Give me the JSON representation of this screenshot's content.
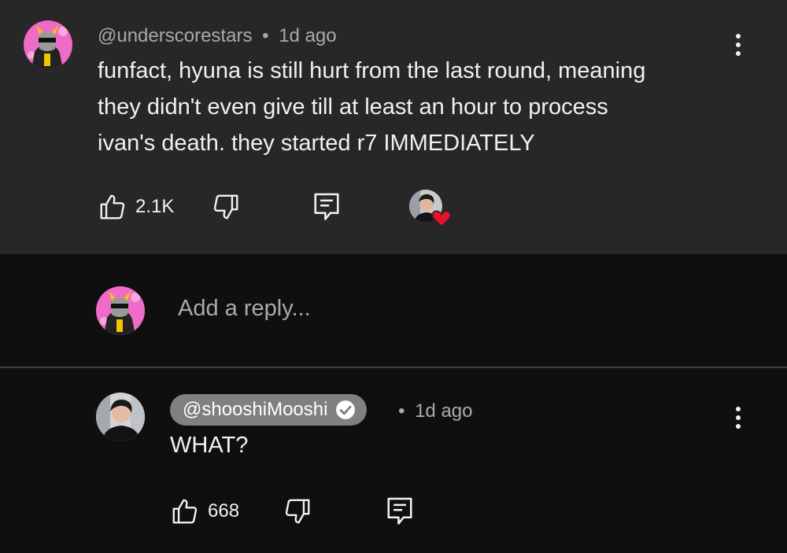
{
  "comment": {
    "author": "@underscorestars",
    "separator": "•",
    "time": "1d ago",
    "lines": [
      "funfact, hyuna is still hurt from the last round, meaning",
      "they didn't even give till at least an hour to process",
      "ivan's death. they started r7 IMMEDIATELY"
    ],
    "likes": "2.1K",
    "icons": [
      "thumbs-up-icon",
      "thumbs-down-icon",
      "reply-icon",
      "creator-heart-icon",
      "more-vert-icon"
    ]
  },
  "reply_box": {
    "placeholder": "Add a reply..."
  },
  "reply": {
    "author": "@shooshiMooshi",
    "separator": "•",
    "time": "1d ago",
    "text": "WHAT?",
    "likes": "668",
    "icons": [
      "verified-check-icon",
      "thumbs-up-icon",
      "thumbs-down-icon",
      "reply-icon",
      "more-vert-icon"
    ]
  },
  "colors": {
    "top_background": "#272727",
    "page_background": "#0f0f0f",
    "heart": "#e8112d",
    "avatar_pink": "#f06bc7",
    "handle_pill": "#808080"
  }
}
